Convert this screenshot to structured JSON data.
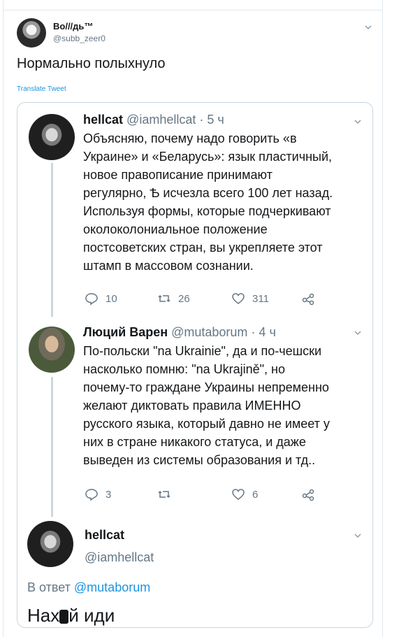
{
  "outer_tweet": {
    "display_name": "Во///дь™",
    "handle": "@subb_zeer0",
    "text": "Нормально полыхнуло",
    "translate_label": "Translate Tweet"
  },
  "quoted_thread": {
    "tweets": [
      {
        "name": "hellcat",
        "handle": "@iamhellcat",
        "time": "· 5 ч",
        "lines": [
          "Объясняю, почему надо говорить «в",
          "Украине» и «Беларусь»: язык пластичный,",
          "новое правописание принимают",
          "регулярно, Ѣ исчезла всего 100 лет назад.",
          "Используя формы, которые подчеркивают",
          "околоколониальное положение",
          "постсоветских стран, вы укрепляете этот",
          "штамп в массовом сознании."
        ],
        "replies": "10",
        "retweets": "26",
        "likes": "311"
      },
      {
        "name": "Люций Варен",
        "handle": "@mutaborum",
        "time": "· 4 ч",
        "lines": [
          "По-польски \"na Ukrainie\", да и по-чешски",
          "насколько помню: \"na Ukrajině\", но",
          "почему-то граждане Украины непременно",
          "желают диктовать правила ИМЕННО",
          "русского языка, который давно не имеет у",
          "них в стране никакого статуса, и даже",
          "выведен из системы образования и тд.."
        ],
        "replies": "3",
        "retweets": "",
        "likes": "6"
      }
    ],
    "focused_reply": {
      "name": "hellcat",
      "handle": "@iamhellcat",
      "reply_prefix": "В ответ",
      "reply_mention": "@mutaborum",
      "text": "Нах",
      "text_end": "й иди"
    }
  },
  "colors": {
    "accent": "#1b95e0",
    "secondary_text": "#657786",
    "border": "#ccd6dd"
  },
  "icons": [
    "chevron-down-icon",
    "reply-icon",
    "retweet-icon",
    "like-icon",
    "share-icon"
  ]
}
